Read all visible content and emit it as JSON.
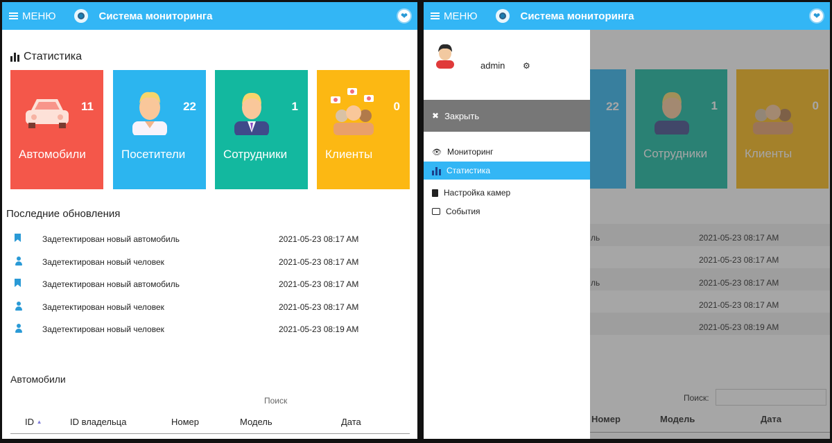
{
  "topbar": {
    "menu_label": "МЕНЮ",
    "title": "Система мониторинга"
  },
  "stats": {
    "heading": "Статистика",
    "cards": [
      {
        "label": "Автомобили",
        "value": "11",
        "color": "#f4574a"
      },
      {
        "label": "Посетители",
        "value": "22",
        "color": "#2cb5ef"
      },
      {
        "label": "Сотрудники",
        "value": "1",
        "color": "#13b89f"
      },
      {
        "label": "Клиенты",
        "value": "0",
        "color": "#fcb813"
      }
    ]
  },
  "updates": {
    "heading": "Последние обновления",
    "rows": [
      {
        "icon": "bookmark-icon",
        "text": "Задетектирован новый автомобиль",
        "date": "2021-05-23 08:17 AM"
      },
      {
        "icon": "person-icon",
        "text": "Задетектирован новый человек",
        "date": "2021-05-23 08:17 AM"
      },
      {
        "icon": "bookmark-icon",
        "text": "Задетектирован новый автомобиль",
        "date": "2021-05-23 08:17 AM"
      },
      {
        "icon": "person-icon",
        "text": "Задетектирован новый человек",
        "date": "2021-05-23 08:17 AM"
      },
      {
        "icon": "person-icon",
        "text": "Задетектирован новый человек",
        "date": "2021-05-23 08:19 AM"
      }
    ]
  },
  "cars_table": {
    "heading": "Автомобили",
    "search_label": "Поиск",
    "search_label_right": "Поиск:",
    "columns": [
      "ID",
      "ID владельца",
      "Номер",
      "Модель",
      "Дата"
    ]
  },
  "drawer": {
    "username": "admin",
    "close_label": "Закрыть",
    "items": [
      {
        "label": "Мониторинг",
        "icon": "eye-icon",
        "active": false
      },
      {
        "label": "Статистика",
        "icon": "bar-chart-icon",
        "active": true
      },
      {
        "label": "Настройка камер",
        "icon": "clipboard-icon",
        "active": false
      },
      {
        "label": "События",
        "icon": "comment-icon",
        "active": false
      }
    ]
  },
  "right_partial": {
    "peek_suffix": "ль"
  },
  "accent_color": "#33b6f5"
}
